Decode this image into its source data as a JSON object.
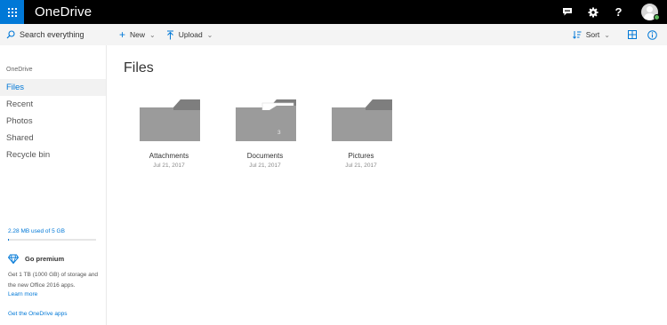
{
  "app": {
    "title": "OneDrive"
  },
  "topbar": {
    "icons": [
      "waffle-icon",
      "chat-icon",
      "gear-icon",
      "help-icon",
      "avatar"
    ],
    "help_label": "?"
  },
  "command_bar": {
    "search_placeholder": "Search everything",
    "new_label": "New",
    "upload_label": "Upload",
    "sort_label": "Sort",
    "view_icon": "grid-icon",
    "info_icon": "info-icon"
  },
  "sidebar": {
    "header": "OneDrive",
    "items": [
      {
        "label": "Files",
        "active": true
      },
      {
        "label": "Recent",
        "active": false
      },
      {
        "label": "Photos",
        "active": false
      },
      {
        "label": "Shared",
        "active": false
      },
      {
        "label": "Recycle bin",
        "active": false
      }
    ],
    "storage": {
      "text": "2.28 MB used of 5 GB",
      "used_fraction": 0.0005
    },
    "premium": {
      "title": "Go premium",
      "description": "Get 1 TB (1000 GB) of storage and the new Office 2016 apps.",
      "learn_more": "Learn more"
    },
    "get_apps": "Get the OneDrive apps"
  },
  "main": {
    "title": "Files",
    "items": [
      {
        "name": "Attachments",
        "date": "Jul 21, 2017",
        "count": ""
      },
      {
        "name": "Documents",
        "date": "Jul 21, 2017",
        "count": "3"
      },
      {
        "name": "Pictures",
        "date": "Jul 21, 2017",
        "count": ""
      }
    ]
  },
  "colors": {
    "accent": "#0078d7",
    "topbar": "#000000",
    "folder_front": "#9b9b9b",
    "folder_back": "#7a7a7a",
    "presence": "#5cb85c"
  }
}
